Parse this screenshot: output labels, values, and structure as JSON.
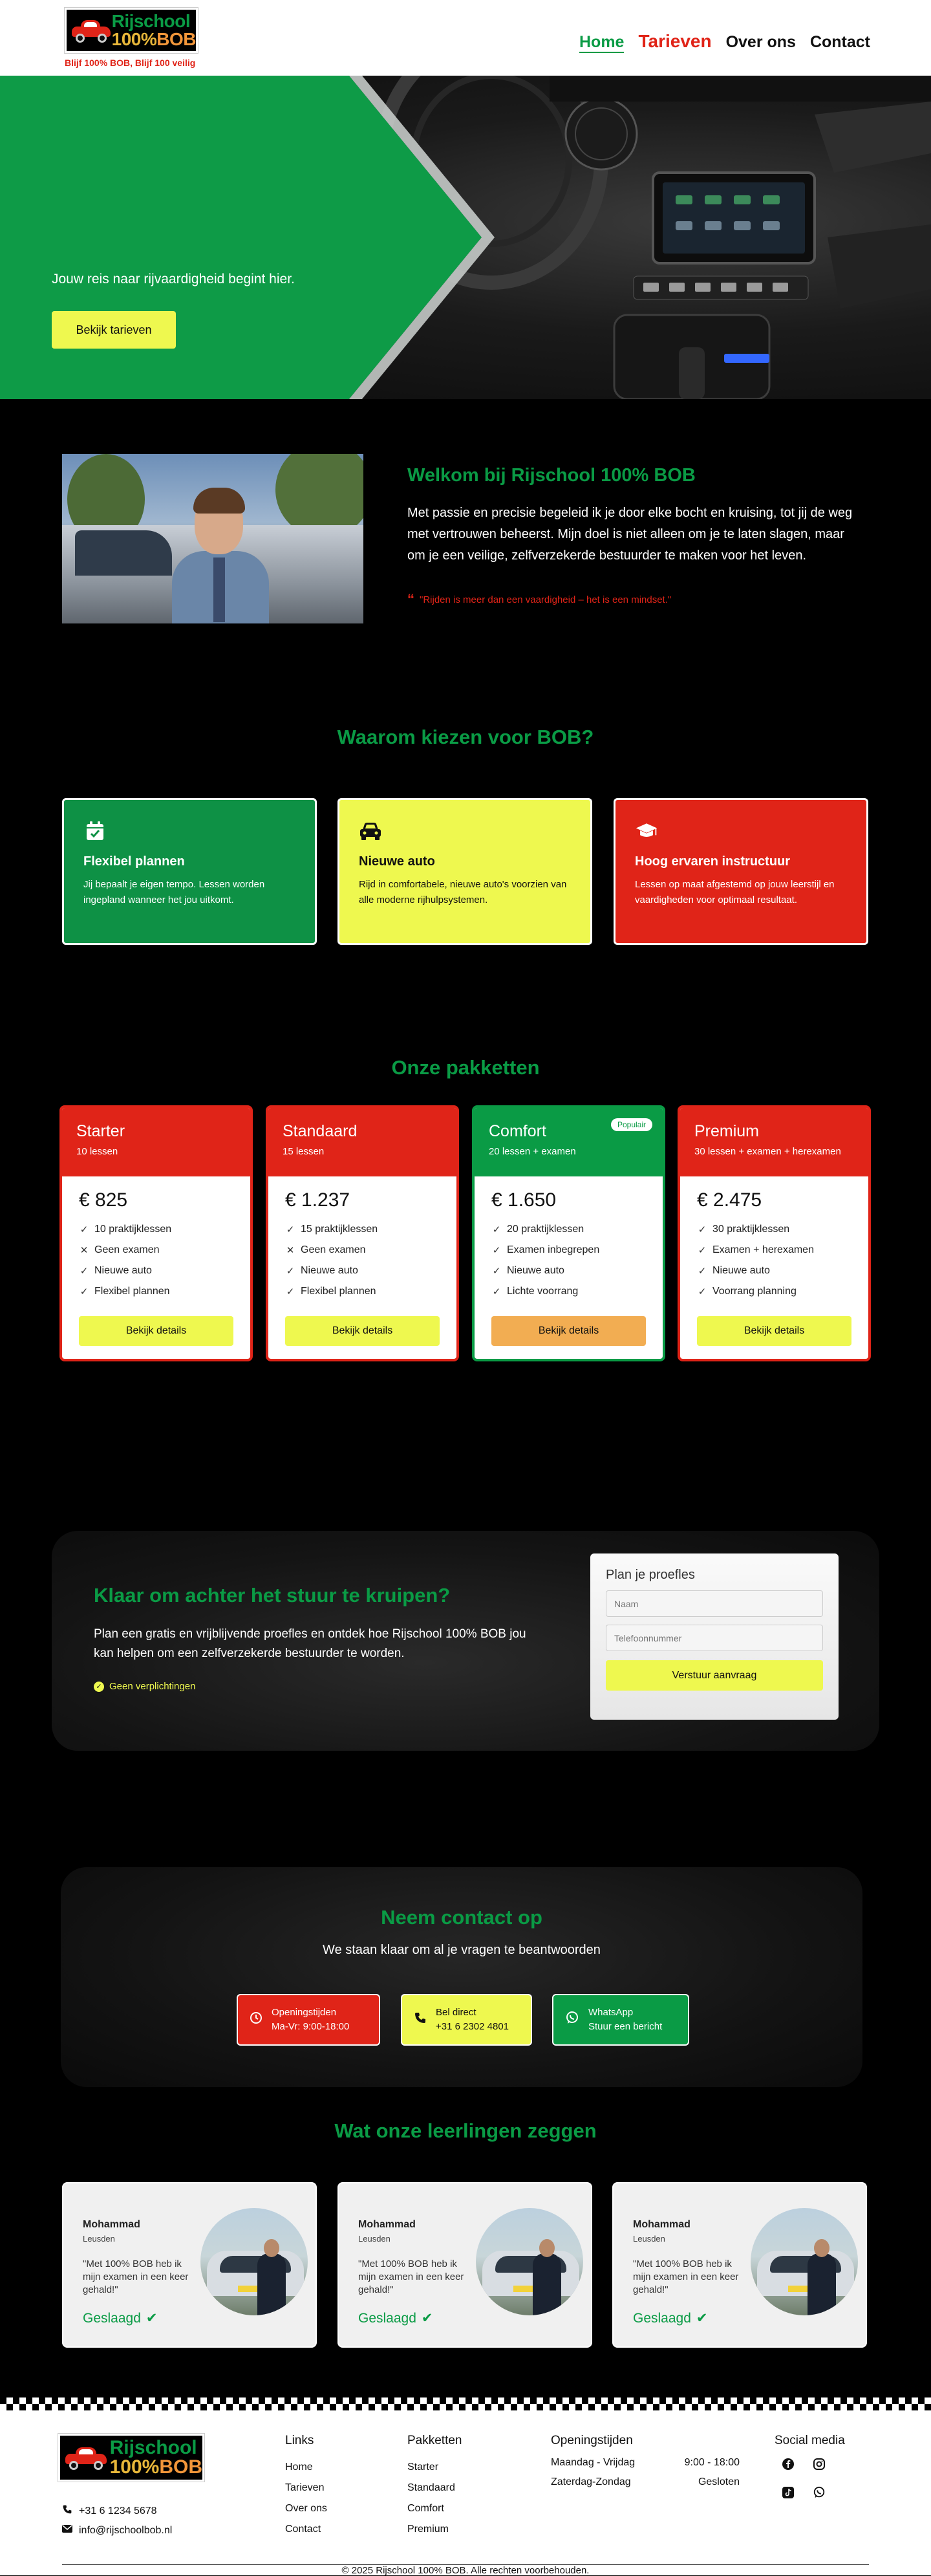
{
  "brand": {
    "logo_line1": "Rijschool",
    "logo_line2_num": "100%",
    "logo_line2_bob": "BOB",
    "tagline": "Blijf 100% BOB, Blijf 100 veilig"
  },
  "nav": {
    "items": [
      "Home",
      "Tarieven",
      "Over ons",
      "Contact"
    ]
  },
  "hero": {
    "subtitle": "Jouw reis naar rijvaardigheid begint hier.",
    "button": "Bekijk tarieven"
  },
  "welcome": {
    "title": "Welkom bij Rijschool 100% BOB",
    "text": "Met passie en precisie begeleid ik je door elke bocht en kruising, tot jij de weg met vertrouwen beheerst. Mijn doel is niet alleen om je te laten slagen, maar om je een veilige, zelfverzekerde bestuurder te maken voor het leven.",
    "quote": "\"Rijden is meer dan een vaardigheid – het is een mindset.\""
  },
  "why": {
    "title": "Waarom kiezen voor BOB?",
    "features": [
      {
        "icon": "calendar-check-icon",
        "title": "Flexibel plannen",
        "text": "Jij bepaalt je eigen tempo. Lessen worden ingepland wanneer het jou uitkomt."
      },
      {
        "icon": "car-icon",
        "title": "Nieuwe auto",
        "text": "Rijd in comfortabele, nieuwe auto's voorzien van alle moderne rijhulpsystemen."
      },
      {
        "icon": "graduation-cap-icon",
        "title": "Hoog ervaren instructuur",
        "text": "Lessen op maat afgestemd op jouw leerstijl en vaardigheden voor optimaal resultaat."
      }
    ]
  },
  "packages": {
    "title": "Onze pakketten",
    "badge": "Populair",
    "button": "Bekijk details",
    "items": [
      {
        "name": "Starter",
        "sub": "10 lessen",
        "price": "€ 825",
        "features": [
          {
            "mark": "check",
            "text": "10 praktijklessen"
          },
          {
            "mark": "x",
            "text": "Geen examen"
          },
          {
            "mark": "check",
            "text": "Nieuwe auto"
          },
          {
            "mark": "check",
            "text": "Flexibel plannen"
          }
        ]
      },
      {
        "name": "Standaard",
        "sub": "15 lessen",
        "price": "€ 1.237",
        "features": [
          {
            "mark": "check",
            "text": "15 praktijklessen"
          },
          {
            "mark": "x",
            "text": "Geen examen"
          },
          {
            "mark": "check",
            "text": "Nieuwe auto"
          },
          {
            "mark": "check",
            "text": "Flexibel plannen"
          }
        ]
      },
      {
        "name": "Comfort",
        "sub": "20 lessen + examen",
        "price": "€ 1.650",
        "features": [
          {
            "mark": "check",
            "text": "20 praktijklessen"
          },
          {
            "mark": "check",
            "text": "Examen inbegrepen"
          },
          {
            "mark": "check",
            "text": "Nieuwe auto"
          },
          {
            "mark": "check",
            "text": "Lichte voorrang"
          }
        ]
      },
      {
        "name": "Premium",
        "sub": "30 lessen + examen + herexamen",
        "price": "€ 2.475",
        "features": [
          {
            "mark": "check",
            "text": "30 praktijklessen"
          },
          {
            "mark": "check",
            "text": "Examen + herexamen"
          },
          {
            "mark": "check",
            "text": "Nieuwe auto"
          },
          {
            "mark": "check",
            "text": "Voorrang planning"
          }
        ]
      }
    ]
  },
  "cta": {
    "title": "Klaar om achter het stuur te kruipen?",
    "text": "Plan een gratis en vrijblijvende proefles en ontdek hoe Rijschool 100% BOB jou kan helpen om een zelfverzekerde bestuurder te worden.",
    "note": "Geen verplichtingen",
    "form_title": "Plan je proefles",
    "name_placeholder": "Naam",
    "phone_placeholder": "Telefoonnummer",
    "submit": "Verstuur aanvraag"
  },
  "contact": {
    "title": "Neem contact op",
    "subtitle": "We staan klaar om al je vragen te beantwoorden",
    "hours_label": "Openingstijden",
    "hours_value": "Ma-Vr: 9:00-18:00",
    "call_label": "Bel direct",
    "call_value": "+31 6 2302 4801",
    "wa_label": "WhatsApp",
    "wa_value": "Stuur een bericht"
  },
  "reviews": {
    "title": "Wat onze leerlingen zeggen",
    "items": [
      {
        "name": "Mohammad",
        "location": "Leusden",
        "quote": "\"Met 100% BOB heb ik mijn examen in een keer gehald!\"",
        "status": "Geslaagd"
      },
      {
        "name": "Mohammad",
        "location": "Leusden",
        "quote": "\"Met 100% BOB heb ik mijn examen in een keer gehald!\"",
        "status": "Geslaagd"
      },
      {
        "name": "Mohammad",
        "location": "Leusden",
        "quote": "\"Met 100% BOB heb ik mijn examen in een keer gehald!\"",
        "status": "Geslaagd"
      }
    ]
  },
  "footer": {
    "phone": "+31 6 1234 5678",
    "email": "info@rijschoolbob.nl",
    "links_title": "Links",
    "links": [
      "Home",
      "Tarieven",
      "Over ons",
      "Contact"
    ],
    "packages_title": "Pakketten",
    "packages": [
      "Starter",
      "Standaard",
      "Comfort",
      "Premium"
    ],
    "hours_title": "Openingstijden",
    "hours": [
      [
        "Maandag - Vrijdag",
        "9:00 - 18:00"
      ],
      [
        "Zaterdag-Zondag",
        "Gesloten"
      ]
    ],
    "social_title": "Social media",
    "social": [
      "facebook-icon",
      "instagram-icon",
      "tiktok-icon",
      "whatsapp-icon"
    ],
    "copyright": "© 2025 Rijschool 100% BOB. Alle rechten voorbehouden."
  },
  "colors": {
    "green": "#0a9b45",
    "red": "#e02418",
    "yellow": "#eef84f",
    "orange": "#f2ad52"
  }
}
